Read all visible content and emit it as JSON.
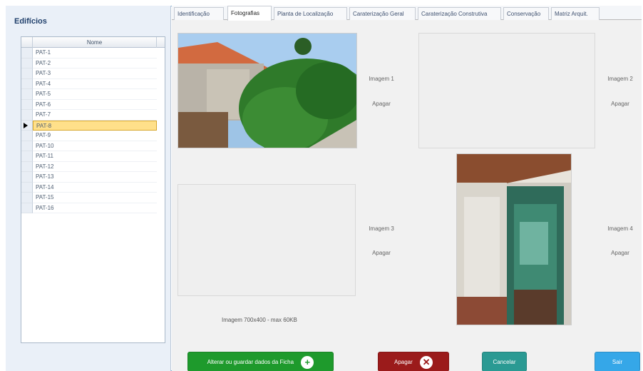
{
  "left": {
    "title": "Edifícios",
    "column_header": "Nome",
    "rows": [
      "PAT-1",
      "PAT-2",
      "PAT-3",
      "PAT-4",
      "PAT-5",
      "PAT-6",
      "PAT-7",
      "PAT-8",
      "PAT-9",
      "PAT-10",
      "PAT-11",
      "PAT-12",
      "PAT-13",
      "PAT-14",
      "PAT-15",
      "PAT-16"
    ],
    "selected_row": "PAT-8"
  },
  "tabs": [
    "Identificação",
    "Fotografias",
    "Planta de Localização",
    "Caraterização Geral",
    "Caraterização Construtiva",
    "Conservação",
    "Matriz Arquit."
  ],
  "active_tab": "Fotografias",
  "photos": {
    "image1_label": "Imagem 1",
    "image2_label": "Imagem 2",
    "image3_label": "Imagem 3",
    "image4_label": "Imagem 4",
    "delete_label": "Apagar",
    "size_note": "Imagem 700x400 - max 60KB"
  },
  "buttons": {
    "save": "Alterar ou guardar dados da Ficha",
    "delete": "Apagar",
    "cancel": "Cancelar",
    "exit": "Sair"
  },
  "colors": {
    "save": "#1e9a2c",
    "delete": "#9b1b1b",
    "cancel": "#2a9a93",
    "exit": "#35a7e8",
    "selected_row": "#ffe08a"
  }
}
